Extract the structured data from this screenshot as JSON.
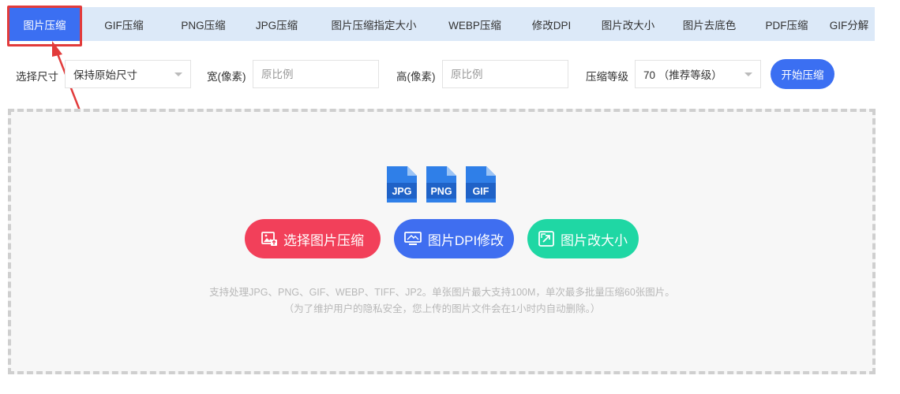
{
  "tabs": [
    {
      "label": "图片压缩",
      "active": true
    },
    {
      "label": "GIF压缩"
    },
    {
      "label": "PNG压缩"
    },
    {
      "label": "JPG压缩"
    },
    {
      "label": "图片压缩指定大小"
    },
    {
      "label": "WEBP压缩"
    },
    {
      "label": "修改DPI"
    },
    {
      "label": "图片改大小"
    },
    {
      "label": "图片去底色"
    },
    {
      "label": "PDF压缩"
    },
    {
      "label": "GIF分解"
    }
  ],
  "options": {
    "size_label": "选择尺寸",
    "size_value": "保持原始尺寸",
    "width_label": "宽(像素)",
    "width_placeholder": "原比例",
    "height_label": "高(像素)",
    "height_placeholder": "原比例",
    "level_label": "压缩等级",
    "level_value": "70 （推荐等级）",
    "start_label": "开始压缩"
  },
  "filetypes": [
    "JPG",
    "PNG",
    "GIF"
  ],
  "actions": {
    "select_label": "选择图片压缩",
    "dpi_label": "图片DPI修改",
    "resize_label": "图片改大小"
  },
  "notes": {
    "line1": "支持处理JPG、PNG、GIF、WEBP、TIFF、JP2。单张图片最大支持100M，单次最多批量压缩60张图片。",
    "line2": "（为了维护用户的隐私安全，您上传的图片文件会在1小时内自动删除。）"
  },
  "colors": {
    "accent": "#3b6ff2",
    "tabbar_bg": "#dce9f8",
    "select_btn": "#f2405a",
    "dpi_btn": "#3f6ef0",
    "resize_btn": "#1fd7a4",
    "annotation": "#e23b3b"
  }
}
